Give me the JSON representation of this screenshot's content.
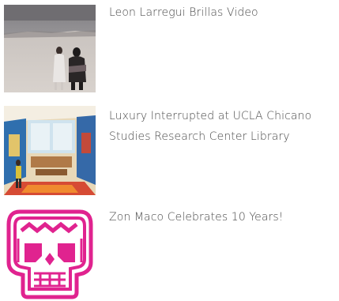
{
  "articles": [
    {
      "title": "Leon Larregui Brillas Video",
      "thumbnail": "desert-couple-photo"
    },
    {
      "title": "Luxury Interrupted at UCLA Chicano Studies Research Center Library",
      "thumbnail": "interior-room-photo"
    },
    {
      "title": "Zon Maco Celebrates 10 Years!",
      "thumbnail": "pink-skull-logo",
      "accent_color": "#e0238f"
    }
  ]
}
